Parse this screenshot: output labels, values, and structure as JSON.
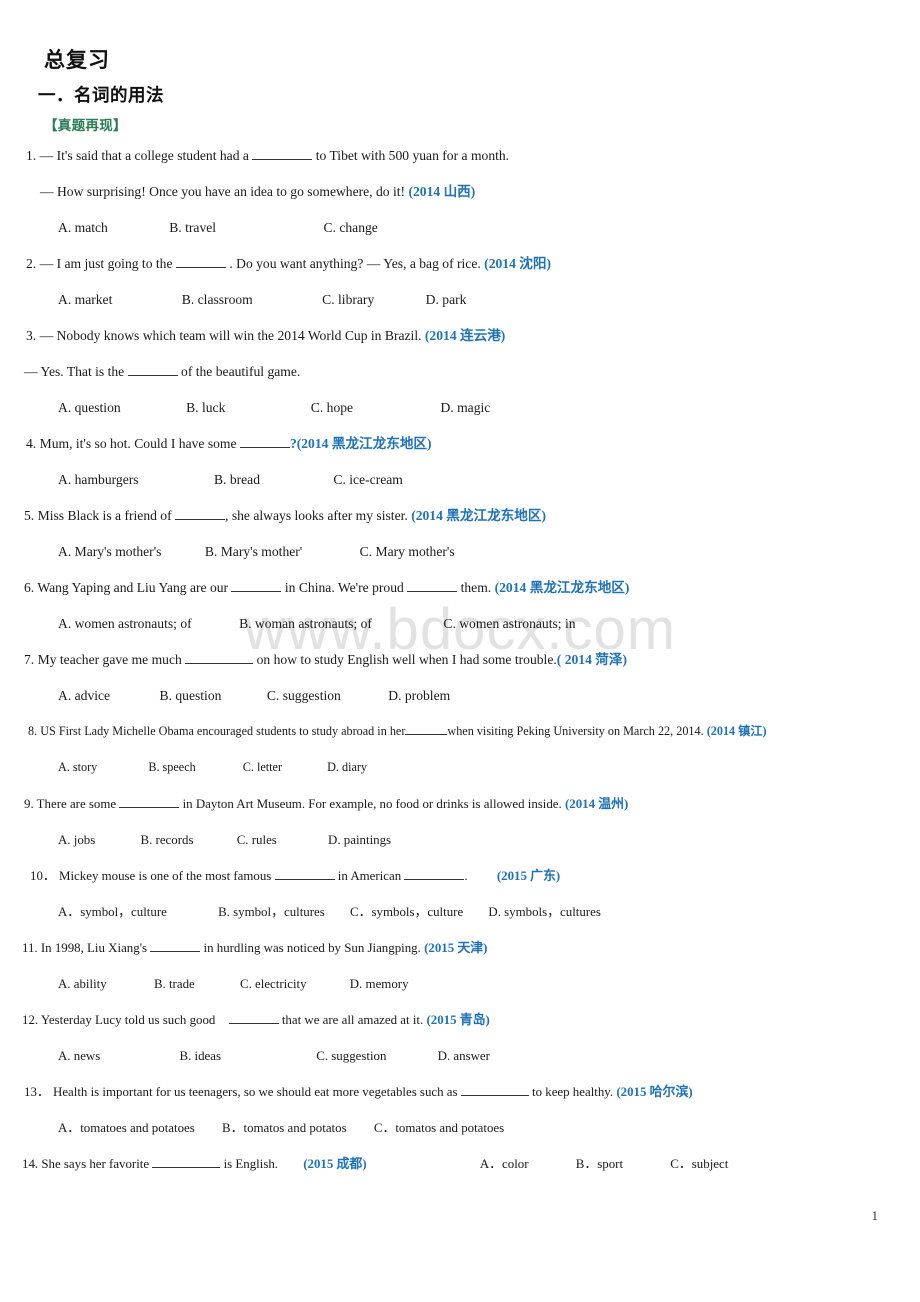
{
  "document": {
    "title": "总复习",
    "section_title": "一．名词的用法",
    "sub_label": "【真题再现】",
    "page_number": "1",
    "watermark": "www.bdocx.com",
    "accent_colors": {
      "source_blue": "#1f72b8",
      "sub_label_green": "#2a7d55",
      "watermark_gray": "#e2e2e2",
      "body_text": "#1a1a1a"
    }
  },
  "questions": [
    {
      "number": "1.",
      "stem_a": "— It's said that a college student had a",
      "stem_a_tail": "to Tibet with 500 yuan for a month.",
      "stem_b": "— How surprising! Once you have an idea to go somewhere, do it!",
      "source": "(2014 山西)",
      "options": [
        "A. match",
        "B. travel",
        "C. change"
      ]
    },
    {
      "number": "2.",
      "stem_a": "— I am just going to the",
      "stem_a_tail": ". Do you want anything?      — Yes, a bag of rice.",
      "source": "(2014 沈阳)",
      "options": [
        "A. market",
        "B. classroom",
        "C. library",
        "D. park"
      ]
    },
    {
      "number": "3.",
      "stem_a": "— Nobody knows which team will win the 2014 World Cup in Brazil.",
      "source": "(2014 连云港)",
      "stem_b_pre": "— Yes. That is the",
      "stem_b_tail": "of the beautiful game.",
      "options": [
        "A. question",
        "B. luck",
        "C. hope",
        "D. magic"
      ]
    },
    {
      "number": "4.",
      "stem_a": "Mum, it's so hot. Could I have some",
      "stem_a_tail": "?",
      "source": "(2014 黑龙江龙东地区)",
      "options": [
        "A. hamburgers",
        "B. bread",
        "C. ice-cream"
      ]
    },
    {
      "number": "5.",
      "stem_a": "Miss Black is a friend of",
      "stem_a_tail": ", she always looks after my sister.",
      "source": "(2014 黑龙江龙东地区)",
      "options": [
        "A. Mary's mother's",
        "B. Mary's mother'",
        "C. Mary mother's"
      ]
    },
    {
      "number": "6.",
      "stem_a": "Wang Yaping and Liu Yang are our",
      "stem_a_mid": "in China. We're proud",
      "stem_a_tail": "them.",
      "source": "(2014 黑龙江龙东地区)",
      "options": [
        "A. women astronauts; of",
        "B. woman astronauts; of",
        "C. women astronauts; in"
      ]
    },
    {
      "number": "7.",
      "stem_a": "My teacher gave me much",
      "stem_a_tail": "on how to study English well when I had some trouble.",
      "source": "( 2014 菏泽)",
      "options": [
        "A. advice",
        "B. question",
        "C. suggestion",
        "D. problem"
      ]
    },
    {
      "number": "8.",
      "stem_a": "US First Lady Michelle Obama encouraged students to study abroad in her",
      "stem_a_tail": "when visiting Peking University on March 22, 2014.",
      "source": "(2014 镇江)",
      "options": [
        "A. story",
        "B. speech",
        "C. letter",
        "D. diary"
      ]
    },
    {
      "number": "9.",
      "stem_a": "There are some",
      "stem_a_tail": "in Dayton Art Museum. For example, no food or drinks is allowed inside.",
      "source": "(2014 温州)",
      "options": [
        "A. jobs",
        "B. records",
        "C. rules",
        "D. paintings"
      ]
    },
    {
      "number": "10．",
      "stem_a": "Mickey mouse is one of the most famous",
      "stem_a_mid": "in American",
      "stem_a_tail": ".",
      "source": "(2015 广东)",
      "options": [
        "A．symbol，culture",
        "B. symbol，cultures",
        "C．symbols，culture",
        "D. symbols，cultures"
      ]
    },
    {
      "number": "11.",
      "stem_a": "In 1998, Liu Xiang's",
      "stem_a_tail": "in hurdling was noticed by Sun Jiangping.",
      "source": "(2015 天津)",
      "options": [
        "A. ability",
        "B. trade",
        "C. electricity",
        "D. memory"
      ]
    },
    {
      "number": "12.",
      "stem_a": "Yesterday Lucy told us such good",
      "stem_a_tail": "that we are all amazed at it.",
      "source": "(2015 青岛)",
      "options": [
        "A. news",
        "B. ideas",
        "C. suggestion",
        "D. answer"
      ]
    },
    {
      "number": "13．",
      "stem_a": "Health is important for us teenagers, so we should eat more vegetables such as",
      "stem_a_tail": "to keep healthy.",
      "source": "(2015 哈尔滨)",
      "options": [
        "A．tomatoes and potatoes",
        "B．tomatos and potatos",
        "C．tomatos and potatoes"
      ]
    },
    {
      "number": "14.",
      "stem_a": "She says her favorite",
      "stem_a_tail": "is English.",
      "source": "(2015 成都)",
      "options": [
        "A．color",
        "B．sport",
        "C．subject"
      ]
    }
  ]
}
